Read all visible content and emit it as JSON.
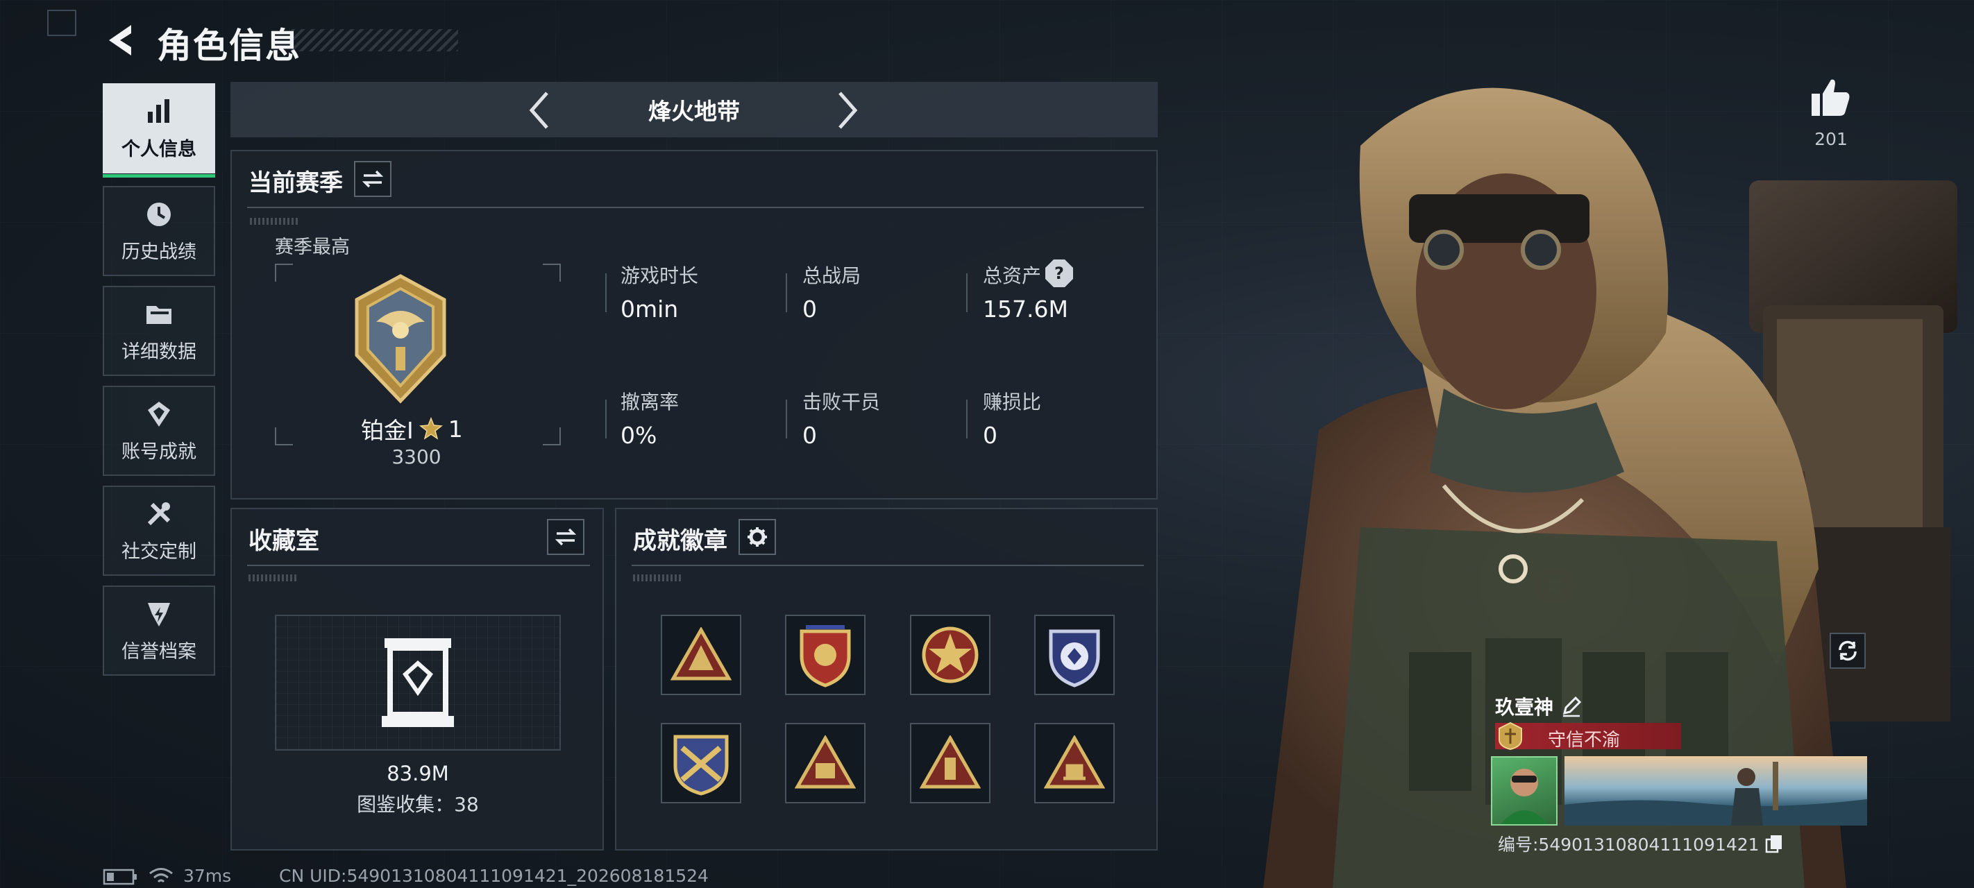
{
  "header": {
    "title": "角色信息",
    "back_icon": "back-arrow-icon"
  },
  "sidebar": {
    "items": [
      {
        "label": "个人信息",
        "icon": "bar-chart-icon",
        "active": true
      },
      {
        "label": "历史战绩",
        "icon": "history-icon",
        "active": false
      },
      {
        "label": "详细数据",
        "icon": "folder-icon",
        "active": false
      },
      {
        "label": "账号成就",
        "icon": "achievement-icon",
        "active": false
      },
      {
        "label": "社交定制",
        "icon": "tools-icon",
        "active": false
      },
      {
        "label": "信誉档案",
        "icon": "credit-icon",
        "active": false
      }
    ]
  },
  "mode_selector": {
    "title": "烽火地带"
  },
  "current_season": {
    "title": "当前赛季",
    "best_label": "赛季最高",
    "rank_name": "铂金I",
    "rank_stars": "1",
    "rank_score": "3300",
    "stats": [
      {
        "label": "游戏时长",
        "value": "0min"
      },
      {
        "label": "总战局",
        "value": "0"
      },
      {
        "label": "总资产",
        "value": "157.6M",
        "help": "?"
      },
      {
        "label": "撤离率",
        "value": "0%"
      },
      {
        "label": "击败干员",
        "value": "0"
      },
      {
        "label": "赚损比",
        "value": "0"
      }
    ]
  },
  "collection": {
    "title": "收藏室",
    "value": "83.9M",
    "count_text": "图鉴收集：38"
  },
  "achievements": {
    "title": "成就徽章",
    "badges": [
      "triangle-badge-icon",
      "shield-badge-icon",
      "star-medal-icon",
      "gem-shield-icon",
      "crossed-shield-icon",
      "sb-triangle-icon",
      "pillar-triangle-icon",
      "tower-triangle-icon"
    ]
  },
  "likes": {
    "count": "201"
  },
  "player_card": {
    "name": "玖壹神",
    "title": "守信不渝",
    "id_text": "编号:549013108041110914​21"
  },
  "status_bar": {
    "ping": "37ms",
    "uid": "CN UID:549013108041110914​21_202608181524"
  },
  "colors": {
    "accent_green": "#2ec77a",
    "gold": "#c9a24a",
    "title_red": "#a0252c"
  }
}
